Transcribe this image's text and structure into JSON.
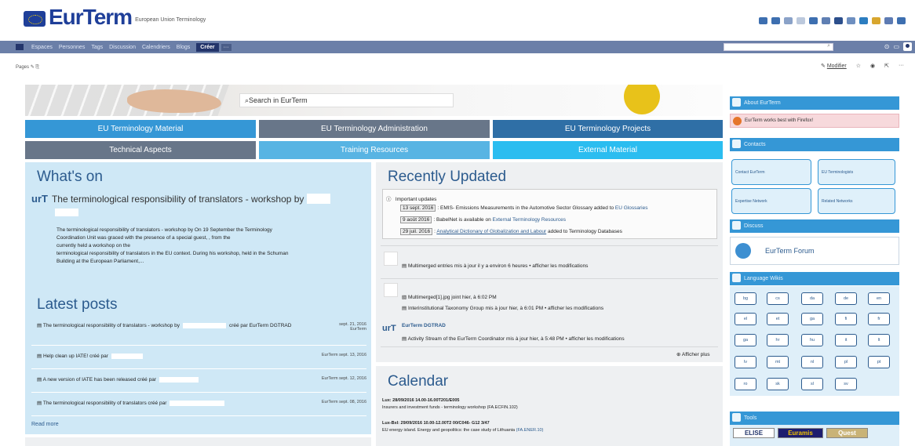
{
  "header": {
    "logo": "EurTerm",
    "subtitle": "European Union Terminology"
  },
  "nav": {
    "items": [
      "Espaces",
      "Personnes",
      "Tags",
      "Discussion",
      "Calendriers",
      "Blogs"
    ],
    "create": "Créer",
    "more": "···",
    "search_icon": "search-icon"
  },
  "pagebar": {
    "pages": "Pages",
    "modify": "Modifier"
  },
  "hero": {
    "search_placeholder": "Search in EurTerm"
  },
  "tiles": [
    {
      "label": "EU Terminology Material",
      "color": "#3597d6"
    },
    {
      "label": "EU Terminology Administration",
      "color": "#687689"
    },
    {
      "label": "EU Terminology Projects",
      "color": "#2f6fa6"
    },
    {
      "label": "Technical Aspects",
      "color": "#687689"
    },
    {
      "label": "Training Resources",
      "color": "#58b4e3"
    },
    {
      "label": "External Material",
      "color": "#2bbdf0"
    }
  ],
  "whats_on": {
    "title": "What's on",
    "item_logo": "urT",
    "item_title": "The terminological responsibility of translators - workshop by",
    "body": [
      "The terminological responsibility of translators - workshop by                     On 19 September the Terminology",
      "Coordination Unit was graced with the presence of a special guest,                , from the",
      "                       currently                                                          held a workshop on the",
      "terminological responsibility of translators in the EU context.     During his workshop, held in the Schuman",
      "Building at the European Parliament,..."
    ]
  },
  "latest_posts": {
    "title": "Latest posts",
    "items": [
      {
        "title": "The terminological responsibility of translators - workshop by",
        "by": "créé par  EurTerm DGTRAD",
        "meta1": "sept. 21, 2016",
        "meta2": "EurTerm"
      },
      {
        "title": "Help clean up IATE! créé par",
        "by": "",
        "meta1": "EurTerm  sept. 13, 2016",
        "meta2": ""
      },
      {
        "title": "A new version of IATE has been released créé par",
        "by": "",
        "meta1": "EurTerm  sept. 12, 2016",
        "meta2": ""
      },
      {
        "title": "The terminological responsibility of translators créé par",
        "by": "",
        "meta1": "EurTerm  sept. 08, 2016",
        "meta2": ""
      }
    ],
    "read_more": "Read more"
  },
  "recently_updated": {
    "title": "Recently Updated",
    "important": "Important updates",
    "updates": [
      {
        "date": "13 sept. 2016",
        "text": ": EMIS- Emissions Measurements in the Automotive Sector Glossary added to ",
        "link": "EU Glossaries"
      },
      {
        "date": "9 août 2016",
        "text": ": BabelNet is available on ",
        "link": "External Terminology Resources"
      },
      {
        "date": "29 juil. 2016",
        "text": ": ",
        "link": "Analytical Dictionary of Globalization and Labour",
        "tail": " added to Terminology Databases"
      }
    ],
    "act1": "Multimerged entries mis à jour il y a environ 6 heures • afficher les modifications",
    "act2": "Multimerged[1].jpg joint hier, à 6:02 PM",
    "act3": "Interinstitutional Taxonomy Group mis à jour hier, à 6:01 PM • afficher les modifications",
    "act4_user": "EurTerm DGTRAD",
    "act4": "Activity Stream of the EurTerm Coordinator mis à jour hier, à 5:48 PM • afficher les modifications",
    "more": "⊕ Afficher plus"
  },
  "calendar": {
    "title": "Calendar",
    "events": [
      {
        "head": "Lux: 28/09/2016 14.00-16.00T201/E005",
        "body": "Insurers and investment funds - terminology workshop (FA.ECFIN.102)"
      },
      {
        "head": "Lux-Bxl: 29/09/2016 10.00-12.00T2 00/C046- G12 3/47",
        "body": "EU energy island. Energy and geopolitics: the case study of Lithuania ",
        "link": "(FA.ENER.10)"
      }
    ]
  },
  "sidebar": {
    "about": "About EurTerm",
    "firefox": "EurTerm works best with Firefox!",
    "contacts": "Contacts",
    "contact_boxes": [
      "Contact EurTerm",
      "EU Terminologists",
      "Expertise Network",
      "Related Networks"
    ],
    "discuss": "Discuss",
    "forum": "EurTerm Forum",
    "language_wikis": "Language Wikis",
    "langs": [
      "bg",
      "cs",
      "da",
      "de",
      "en",
      "el",
      "et",
      "ga",
      "fi",
      "fr",
      "ga",
      "hr",
      "hu",
      "it",
      "lt",
      "lv",
      "mt",
      "nl",
      "pl",
      "pt",
      "ro",
      "sk",
      "sl",
      "sv"
    ],
    "tools": "Tools",
    "tool_buttons": [
      "ELISE",
      "Euramis",
      "Quest"
    ]
  }
}
